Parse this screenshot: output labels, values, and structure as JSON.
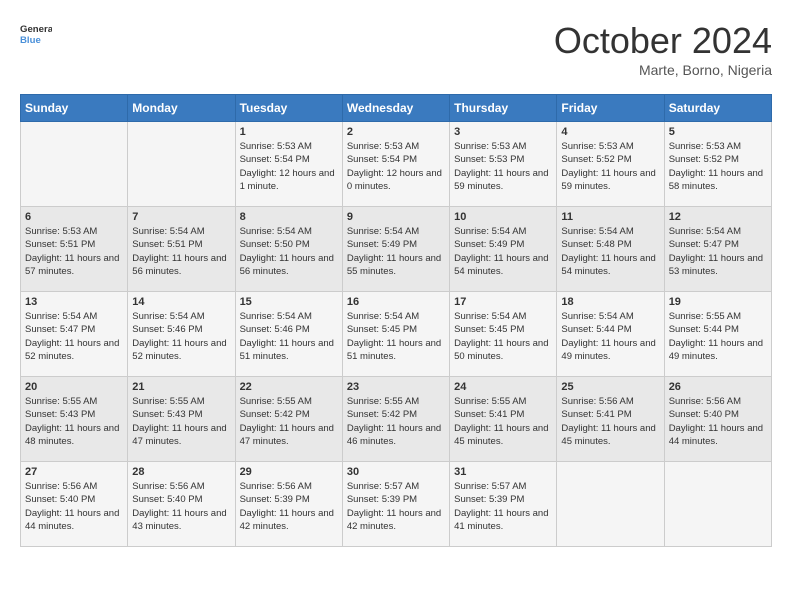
{
  "logo": {
    "line1": "General",
    "line2": "Blue"
  },
  "title": "October 2024",
  "location": "Marte, Borno, Nigeria",
  "days_of_week": [
    "Sunday",
    "Monday",
    "Tuesday",
    "Wednesday",
    "Thursday",
    "Friday",
    "Saturday"
  ],
  "weeks": [
    [
      {
        "num": "",
        "sunrise": "",
        "sunset": "",
        "daylight": ""
      },
      {
        "num": "",
        "sunrise": "",
        "sunset": "",
        "daylight": ""
      },
      {
        "num": "1",
        "sunrise": "Sunrise: 5:53 AM",
        "sunset": "Sunset: 5:54 PM",
        "daylight": "Daylight: 12 hours and 1 minute."
      },
      {
        "num": "2",
        "sunrise": "Sunrise: 5:53 AM",
        "sunset": "Sunset: 5:54 PM",
        "daylight": "Daylight: 12 hours and 0 minutes."
      },
      {
        "num": "3",
        "sunrise": "Sunrise: 5:53 AM",
        "sunset": "Sunset: 5:53 PM",
        "daylight": "Daylight: 11 hours and 59 minutes."
      },
      {
        "num": "4",
        "sunrise": "Sunrise: 5:53 AM",
        "sunset": "Sunset: 5:52 PM",
        "daylight": "Daylight: 11 hours and 59 minutes."
      },
      {
        "num": "5",
        "sunrise": "Sunrise: 5:53 AM",
        "sunset": "Sunset: 5:52 PM",
        "daylight": "Daylight: 11 hours and 58 minutes."
      }
    ],
    [
      {
        "num": "6",
        "sunrise": "Sunrise: 5:53 AM",
        "sunset": "Sunset: 5:51 PM",
        "daylight": "Daylight: 11 hours and 57 minutes."
      },
      {
        "num": "7",
        "sunrise": "Sunrise: 5:54 AM",
        "sunset": "Sunset: 5:51 PM",
        "daylight": "Daylight: 11 hours and 56 minutes."
      },
      {
        "num": "8",
        "sunrise": "Sunrise: 5:54 AM",
        "sunset": "Sunset: 5:50 PM",
        "daylight": "Daylight: 11 hours and 56 minutes."
      },
      {
        "num": "9",
        "sunrise": "Sunrise: 5:54 AM",
        "sunset": "Sunset: 5:49 PM",
        "daylight": "Daylight: 11 hours and 55 minutes."
      },
      {
        "num": "10",
        "sunrise": "Sunrise: 5:54 AM",
        "sunset": "Sunset: 5:49 PM",
        "daylight": "Daylight: 11 hours and 54 minutes."
      },
      {
        "num": "11",
        "sunrise": "Sunrise: 5:54 AM",
        "sunset": "Sunset: 5:48 PM",
        "daylight": "Daylight: 11 hours and 54 minutes."
      },
      {
        "num": "12",
        "sunrise": "Sunrise: 5:54 AM",
        "sunset": "Sunset: 5:47 PM",
        "daylight": "Daylight: 11 hours and 53 minutes."
      }
    ],
    [
      {
        "num": "13",
        "sunrise": "Sunrise: 5:54 AM",
        "sunset": "Sunset: 5:47 PM",
        "daylight": "Daylight: 11 hours and 52 minutes."
      },
      {
        "num": "14",
        "sunrise": "Sunrise: 5:54 AM",
        "sunset": "Sunset: 5:46 PM",
        "daylight": "Daylight: 11 hours and 52 minutes."
      },
      {
        "num": "15",
        "sunrise": "Sunrise: 5:54 AM",
        "sunset": "Sunset: 5:46 PM",
        "daylight": "Daylight: 11 hours and 51 minutes."
      },
      {
        "num": "16",
        "sunrise": "Sunrise: 5:54 AM",
        "sunset": "Sunset: 5:45 PM",
        "daylight": "Daylight: 11 hours and 51 minutes."
      },
      {
        "num": "17",
        "sunrise": "Sunrise: 5:54 AM",
        "sunset": "Sunset: 5:45 PM",
        "daylight": "Daylight: 11 hours and 50 minutes."
      },
      {
        "num": "18",
        "sunrise": "Sunrise: 5:54 AM",
        "sunset": "Sunset: 5:44 PM",
        "daylight": "Daylight: 11 hours and 49 minutes."
      },
      {
        "num": "19",
        "sunrise": "Sunrise: 5:55 AM",
        "sunset": "Sunset: 5:44 PM",
        "daylight": "Daylight: 11 hours and 49 minutes."
      }
    ],
    [
      {
        "num": "20",
        "sunrise": "Sunrise: 5:55 AM",
        "sunset": "Sunset: 5:43 PM",
        "daylight": "Daylight: 11 hours and 48 minutes."
      },
      {
        "num": "21",
        "sunrise": "Sunrise: 5:55 AM",
        "sunset": "Sunset: 5:43 PM",
        "daylight": "Daylight: 11 hours and 47 minutes."
      },
      {
        "num": "22",
        "sunrise": "Sunrise: 5:55 AM",
        "sunset": "Sunset: 5:42 PM",
        "daylight": "Daylight: 11 hours and 47 minutes."
      },
      {
        "num": "23",
        "sunrise": "Sunrise: 5:55 AM",
        "sunset": "Sunset: 5:42 PM",
        "daylight": "Daylight: 11 hours and 46 minutes."
      },
      {
        "num": "24",
        "sunrise": "Sunrise: 5:55 AM",
        "sunset": "Sunset: 5:41 PM",
        "daylight": "Daylight: 11 hours and 45 minutes."
      },
      {
        "num": "25",
        "sunrise": "Sunrise: 5:56 AM",
        "sunset": "Sunset: 5:41 PM",
        "daylight": "Daylight: 11 hours and 45 minutes."
      },
      {
        "num": "26",
        "sunrise": "Sunrise: 5:56 AM",
        "sunset": "Sunset: 5:40 PM",
        "daylight": "Daylight: 11 hours and 44 minutes."
      }
    ],
    [
      {
        "num": "27",
        "sunrise": "Sunrise: 5:56 AM",
        "sunset": "Sunset: 5:40 PM",
        "daylight": "Daylight: 11 hours and 44 minutes."
      },
      {
        "num": "28",
        "sunrise": "Sunrise: 5:56 AM",
        "sunset": "Sunset: 5:40 PM",
        "daylight": "Daylight: 11 hours and 43 minutes."
      },
      {
        "num": "29",
        "sunrise": "Sunrise: 5:56 AM",
        "sunset": "Sunset: 5:39 PM",
        "daylight": "Daylight: 11 hours and 42 minutes."
      },
      {
        "num": "30",
        "sunrise": "Sunrise: 5:57 AM",
        "sunset": "Sunset: 5:39 PM",
        "daylight": "Daylight: 11 hours and 42 minutes."
      },
      {
        "num": "31",
        "sunrise": "Sunrise: 5:57 AM",
        "sunset": "Sunset: 5:39 PM",
        "daylight": "Daylight: 11 hours and 41 minutes."
      },
      {
        "num": "",
        "sunrise": "",
        "sunset": "",
        "daylight": ""
      },
      {
        "num": "",
        "sunrise": "",
        "sunset": "",
        "daylight": ""
      }
    ]
  ]
}
